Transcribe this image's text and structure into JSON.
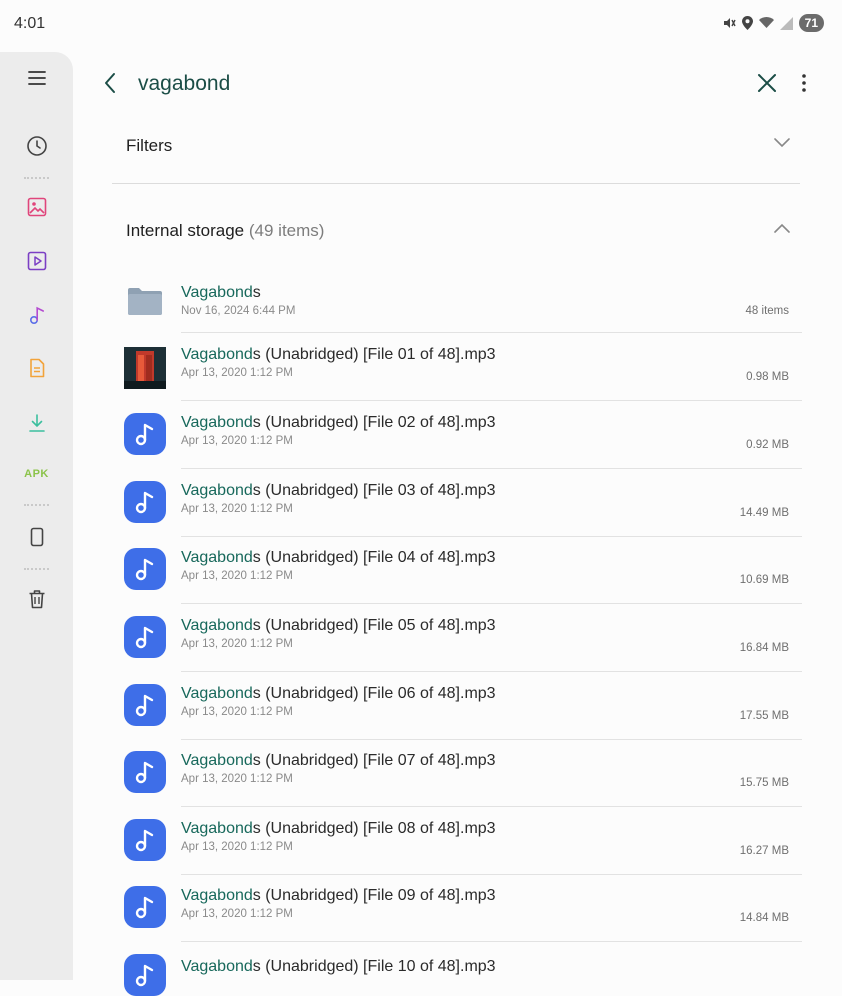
{
  "status_bar": {
    "time": "4:01",
    "battery": "71"
  },
  "rail": {
    "items": [
      {
        "name": "recent",
        "icon": "clock-icon"
      },
      {
        "name": "images",
        "icon": "image-icon",
        "color": "#e0457b"
      },
      {
        "name": "videos",
        "icon": "video-icon",
        "color": "#7b3fc4"
      },
      {
        "name": "audio",
        "icon": "music-note-icon",
        "color": "#5b6ee8"
      },
      {
        "name": "documents",
        "icon": "document-icon",
        "color": "#f2a33a"
      },
      {
        "name": "downloads",
        "icon": "download-icon",
        "color": "#3bbf9e"
      },
      {
        "name": "apk",
        "label": "APK",
        "color": "#8bc34a"
      },
      {
        "name": "internal-storage",
        "icon": "phone-icon"
      },
      {
        "name": "trash",
        "icon": "trash-icon"
      }
    ]
  },
  "search": {
    "query": "vagabond"
  },
  "filters": {
    "label": "Filters"
  },
  "storage": {
    "label": "Internal storage",
    "count": "(49 items)"
  },
  "files": [
    {
      "type": "folder",
      "name_highlight": "Vagabond",
      "name_rest": "s",
      "date": "Nov 16, 2024 6:44 PM",
      "size": "48 items"
    },
    {
      "type": "album",
      "name_highlight": "Vagabond",
      "name_rest": "s (Unabridged) [File 01 of 48].mp3",
      "date": "Apr 13, 2020 1:12 PM",
      "size": "0.98 MB"
    },
    {
      "type": "music",
      "name_highlight": "Vagabond",
      "name_rest": "s (Unabridged) [File 02 of 48].mp3",
      "date": "Apr 13, 2020 1:12 PM",
      "size": "0.92 MB"
    },
    {
      "type": "music",
      "name_highlight": "Vagabond",
      "name_rest": "s (Unabridged) [File 03 of 48].mp3",
      "date": "Apr 13, 2020 1:12 PM",
      "size": "14.49 MB"
    },
    {
      "type": "music",
      "name_highlight": "Vagabond",
      "name_rest": "s (Unabridged) [File 04 of 48].mp3",
      "date": "Apr 13, 2020 1:12 PM",
      "size": "10.69 MB"
    },
    {
      "type": "music",
      "name_highlight": "Vagabond",
      "name_rest": "s (Unabridged) [File 05 of 48].mp3",
      "date": "Apr 13, 2020 1:12 PM",
      "size": "16.84 MB"
    },
    {
      "type": "music",
      "name_highlight": "Vagabond",
      "name_rest": "s (Unabridged) [File 06 of 48].mp3",
      "date": "Apr 13, 2020 1:12 PM",
      "size": "17.55 MB"
    },
    {
      "type": "music",
      "name_highlight": "Vagabond",
      "name_rest": "s (Unabridged) [File 07 of 48].mp3",
      "date": "Apr 13, 2020 1:12 PM",
      "size": "15.75 MB"
    },
    {
      "type": "music",
      "name_highlight": "Vagabond",
      "name_rest": "s (Unabridged) [File 08 of 48].mp3",
      "date": "Apr 13, 2020 1:12 PM",
      "size": "16.27 MB"
    },
    {
      "type": "music",
      "name_highlight": "Vagabond",
      "name_rest": "s (Unabridged) [File 09 of 48].mp3",
      "date": "Apr 13, 2020 1:12 PM",
      "size": "14.84 MB"
    },
    {
      "type": "music",
      "name_highlight": "Vagabond",
      "name_rest": "s (Unabridged) [File 10 of 48].mp3",
      "date": "",
      "size": ""
    }
  ],
  "colors": {
    "accent": "#17685b",
    "music_tile": "#3e6ee8",
    "rail_bg": "#ececec"
  }
}
